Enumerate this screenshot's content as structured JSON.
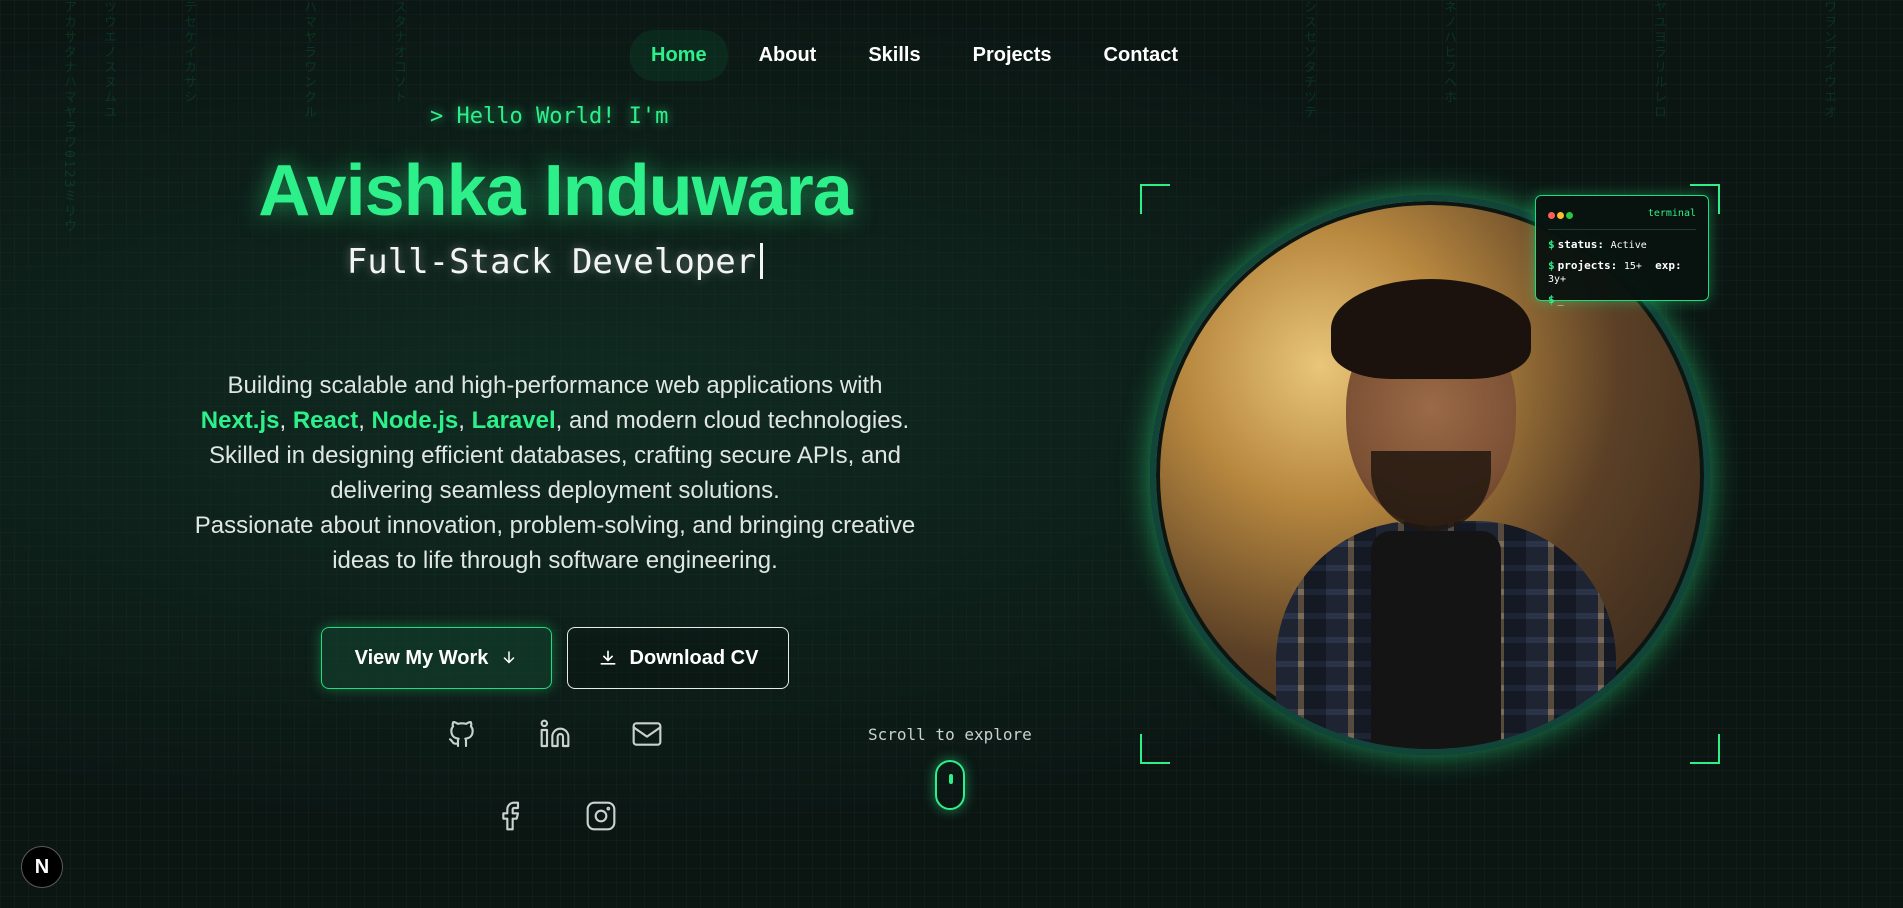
{
  "nav": {
    "items": [
      {
        "label": "Home",
        "active": true
      },
      {
        "label": "About",
        "active": false
      },
      {
        "label": "Skills",
        "active": false
      },
      {
        "label": "Projects",
        "active": false
      },
      {
        "label": "Contact",
        "active": false
      }
    ]
  },
  "hero": {
    "greeting": "> Hello World! I'm",
    "name": "Avishka Induwara",
    "role": "Full-Stack Developer",
    "bio": {
      "line1_prefix": "Building scalable and high-performance web applications with ",
      "tech": [
        "Next.js",
        "React",
        "Node.js",
        "Laravel"
      ],
      "sep1": ", ",
      "sep2": ", ",
      "sep3": ", ",
      "line1_suffix": ", and modern cloud technologies.",
      "line2": "Skilled in designing efficient databases, crafting secure APIs, and delivering seamless deployment solutions.",
      "line3": "Passionate about innovation, problem-solving, and bringing creative ideas to life through software engineering."
    },
    "buttons": {
      "view_work": "View My Work",
      "download_cv": "Download CV"
    }
  },
  "scroll": {
    "label": "Scroll to explore"
  },
  "terminal": {
    "title": "terminal",
    "prompt": "$",
    "status_key": "status:",
    "status_value": "Active",
    "projects_key": "projects:",
    "projects_value": "15+",
    "exp_key": "exp:",
    "exp_value": "3y+",
    "cursor": "_"
  },
  "badge": {
    "letter": "N"
  },
  "colors": {
    "accent": "#2ef08a",
    "background": "#0b1613",
    "dot_red": "#ff5f56",
    "dot_yellow": "#ffbd2e",
    "dot_green": "#27c93f"
  },
  "icons": [
    "github-icon",
    "linkedin-icon",
    "mail-icon",
    "facebook-icon",
    "instagram-icon",
    "arrow-down-icon",
    "download-icon"
  ]
}
